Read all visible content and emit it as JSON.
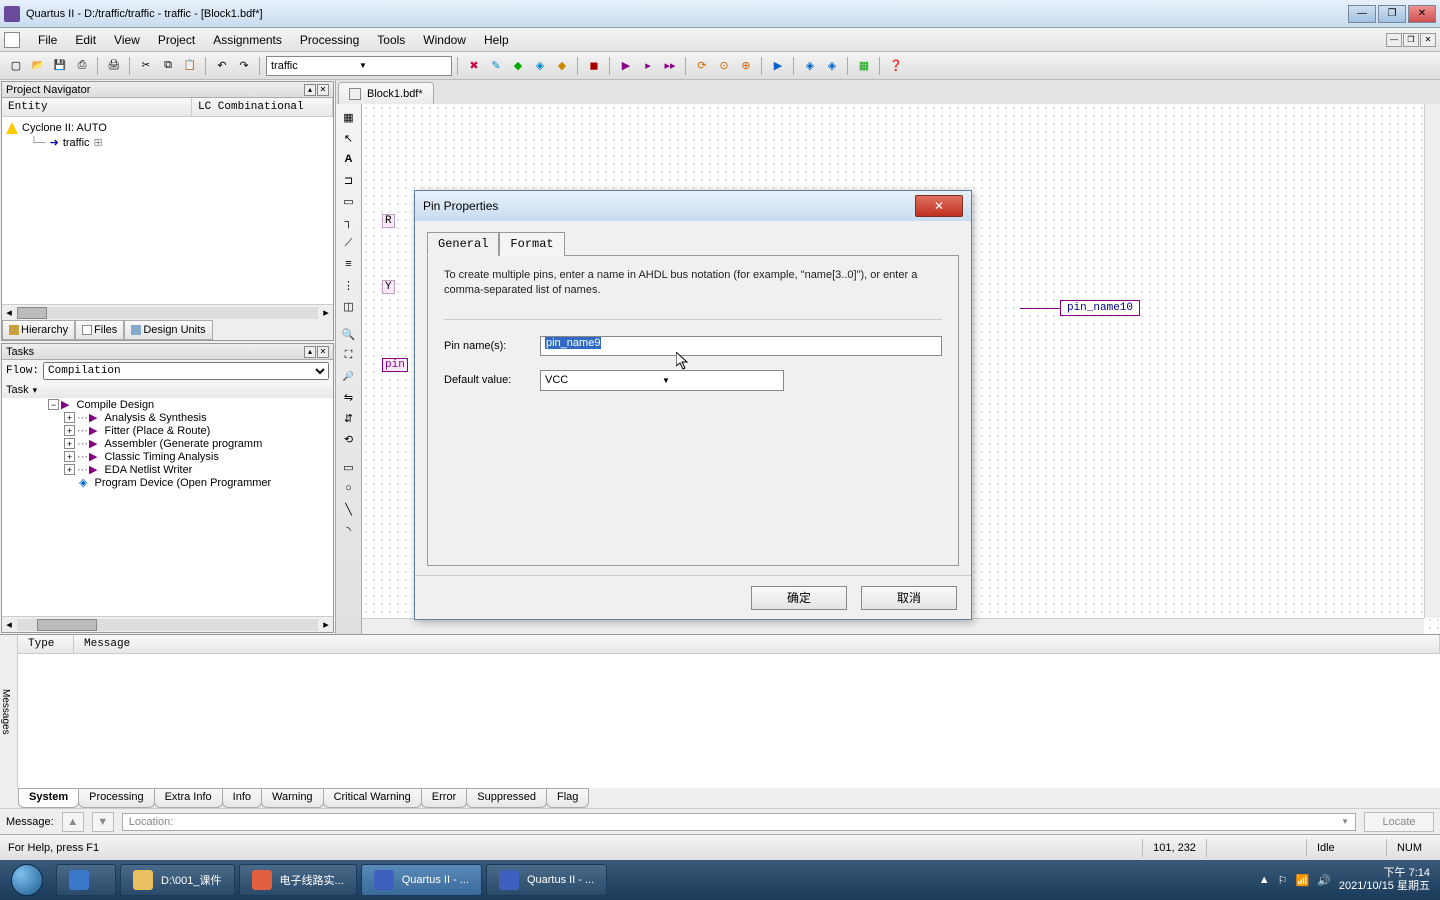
{
  "window": {
    "title": "Quartus II - D:/traffic/traffic - traffic - [Block1.bdf*]"
  },
  "menubar": [
    "File",
    "Edit",
    "View",
    "Project",
    "Assignments",
    "Processing",
    "Tools",
    "Window",
    "Help"
  ],
  "toolbar": {
    "combo_value": "traffic"
  },
  "project_nav": {
    "title": "Project Navigator",
    "headers": [
      "Entity",
      "LC Combinational"
    ],
    "root": "Cyclone II: AUTO",
    "child": "traffic",
    "tabs": [
      "Hierarchy",
      "Files",
      "Design Units"
    ]
  },
  "tasks": {
    "title": "Tasks",
    "flow_label": "Flow:",
    "flow_value": "Compilation",
    "header": "Task",
    "items": [
      "Compile Design",
      "Analysis & Synthesis",
      "Fitter (Place & Route)",
      "Assembler (Generate programm",
      "Classic Timing Analysis",
      "EDA Netlist Writer",
      "Program Device (Open Programmer"
    ]
  },
  "doc": {
    "tab": "Block1.bdf*",
    "pin_r": "R",
    "pin_y": "Y",
    "pin_out_label": "pin_name10"
  },
  "dialog": {
    "title": "Pin Properties",
    "tabs": [
      "General",
      "Format"
    ],
    "help": "To create multiple pins, enter a name in AHDL bus notation (for example, \"name[3..0]\"), or enter a comma-separated list of names.",
    "pin_label": "Pin name(s):",
    "pin_value": "pin_name9",
    "default_label": "Default value:",
    "default_value": "VCC",
    "ok": "确定",
    "cancel": "取消"
  },
  "messages": {
    "side": "Messages",
    "headers": [
      "Type",
      "Message"
    ],
    "tabs": [
      "System",
      "Processing",
      "Extra Info",
      "Info",
      "Warning",
      "Critical Warning",
      "Error",
      "Suppressed",
      "Flag"
    ],
    "msg_label": "Message:",
    "loc_placeholder": "Location:",
    "locate": "Locate"
  },
  "statusbar": {
    "help": "For Help, press F1",
    "coords": "101, 232",
    "idle": "Idle",
    "num": "NUM"
  },
  "taskbar": {
    "items": [
      {
        "label": "",
        "color": "#3a78c8"
      },
      {
        "label": "D:\\001_课件",
        "color": "#e8c060"
      },
      {
        "label": "电子线路实...",
        "color": "#e06040"
      },
      {
        "label": "Quartus II - ...",
        "color": "#4060c0"
      },
      {
        "label": "Quartus II - ...",
        "color": "#4060c0"
      }
    ],
    "time": "下午 7:14",
    "date": "2021/10/15 星期五"
  }
}
